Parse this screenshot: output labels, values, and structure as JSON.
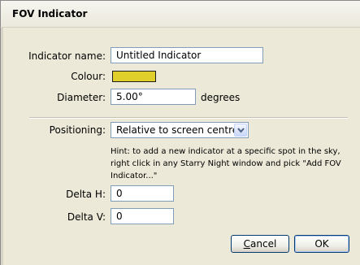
{
  "window": {
    "title": "FOV Indicator"
  },
  "form": {
    "indicator_name_label": "Indicator name:",
    "indicator_name_value": "Untitled Indicator",
    "colour_label": "Colour:",
    "colour_value": "#e0cf2a",
    "diameter_label": "Diameter:",
    "diameter_value": "5.00°",
    "diameter_unit": "degrees",
    "positioning_label": "Positioning:",
    "positioning_selected": "Relative to screen centre",
    "hint_text": "Hint: to add a new indicator at a specific spot in the sky, right click in any Starry Night window and pick \"Add FOV Indicator...\"",
    "delta_h_label": "Delta H:",
    "delta_h_value": "0",
    "delta_v_label": "Delta V:",
    "delta_v_value": "0"
  },
  "buttons": {
    "cancel_mnemonic": "C",
    "cancel_rest": "ancel",
    "ok_label": "OK"
  },
  "icons": {
    "dropdown": "chevron-down-icon"
  }
}
